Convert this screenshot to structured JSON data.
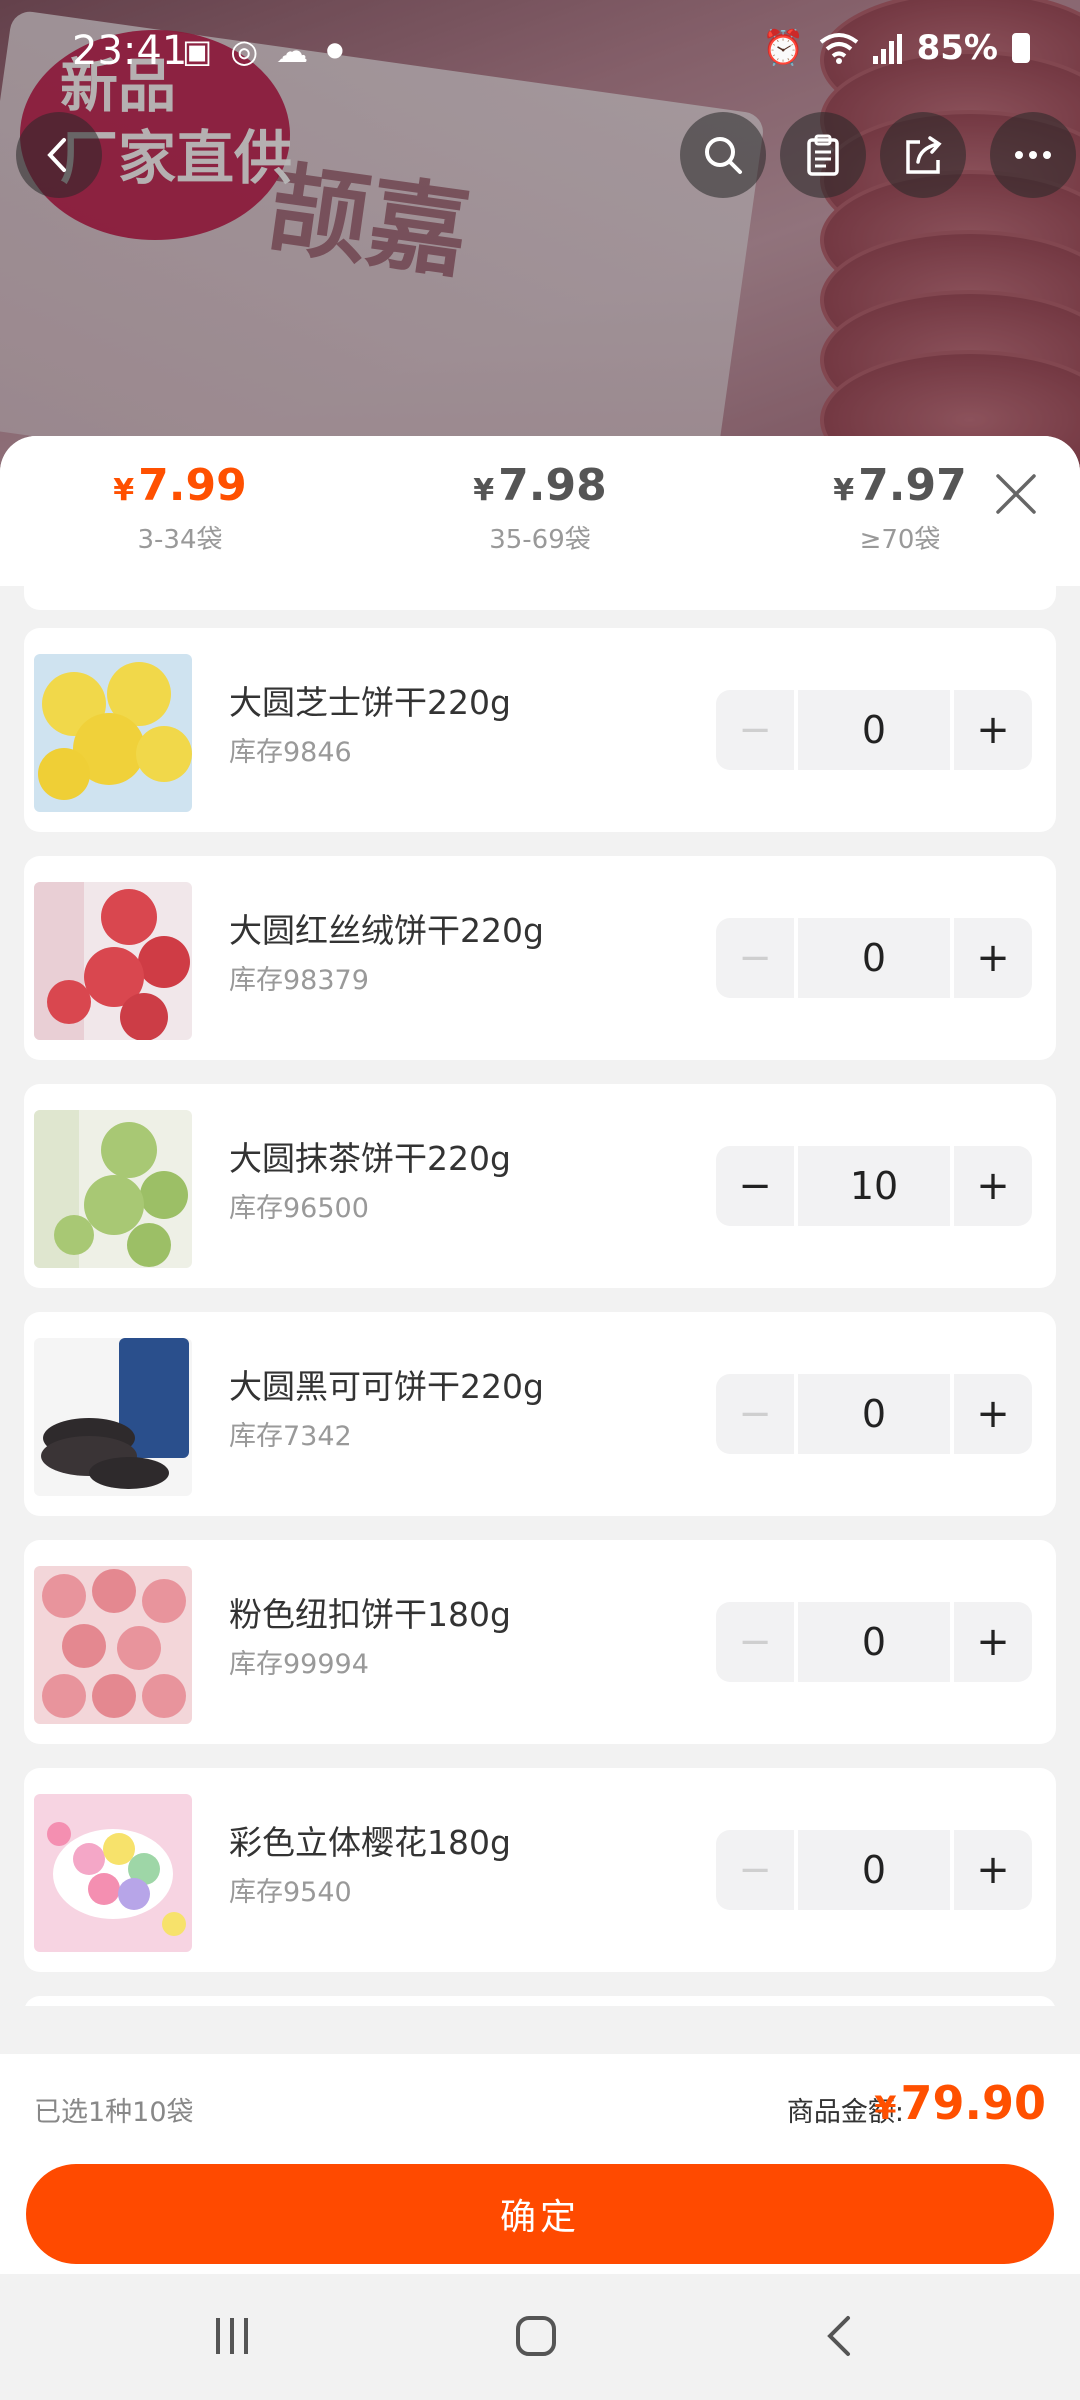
{
  "status_bar": {
    "time": "23:41",
    "battery": "85%",
    "left_icons": [
      "image-icon",
      "instagram-icon",
      "cloud-icon",
      "dot-icon"
    ],
    "right_icons": [
      "alarm-icon",
      "wifi-icon",
      "signal-icon",
      "battery-icon"
    ]
  },
  "hero": {
    "badge_text_1": "新品",
    "badge_text_2": "厂家直供"
  },
  "top_nav": {
    "back": "back-icon",
    "search": "search-icon",
    "clipboard": "clipboard-icon",
    "share": "share-icon",
    "more": "more-icon"
  },
  "price_tiers": [
    {
      "currency": "¥",
      "price": "7.99",
      "range": "3-34袋",
      "active": true
    },
    {
      "currency": "¥",
      "price": "7.98",
      "range": "35-69袋",
      "active": false
    },
    {
      "currency": "¥",
      "price": "7.97",
      "range": "≥70袋",
      "active": false
    }
  ],
  "products": [
    {
      "name": "大圆芝士饼干220g",
      "stock": "库存9846",
      "qty": "0",
      "thumb_color": "#f1d84a"
    },
    {
      "name": "大圆红丝绒饼干220g",
      "stock": "库存98379",
      "qty": "0",
      "thumb_color": "#d9474f"
    },
    {
      "name": "大圆抹茶饼干220g",
      "stock": "库存96500",
      "qty": "10",
      "thumb_color": "#a8c874"
    },
    {
      "name": "大圆黑可可饼干220g",
      "stock": "库存7342",
      "qty": "0",
      "thumb_color": "#2e2a2c"
    },
    {
      "name": "粉色纽扣饼干180g",
      "stock": "库存99994",
      "qty": "0",
      "thumb_color": "#e8949c"
    },
    {
      "name": "彩色立体樱花180g",
      "stock": "库存9540",
      "qty": "0",
      "thumb_color": "#f4a7c7"
    }
  ],
  "stepper": {
    "minus": "−",
    "plus": "+"
  },
  "footer": {
    "selected": "已选1种10袋",
    "total_label": "商品金额:",
    "currency": "¥",
    "total": "79.90",
    "confirm": "确定"
  },
  "colors": {
    "accent": "#ff5000",
    "button": "#ff4a00"
  }
}
